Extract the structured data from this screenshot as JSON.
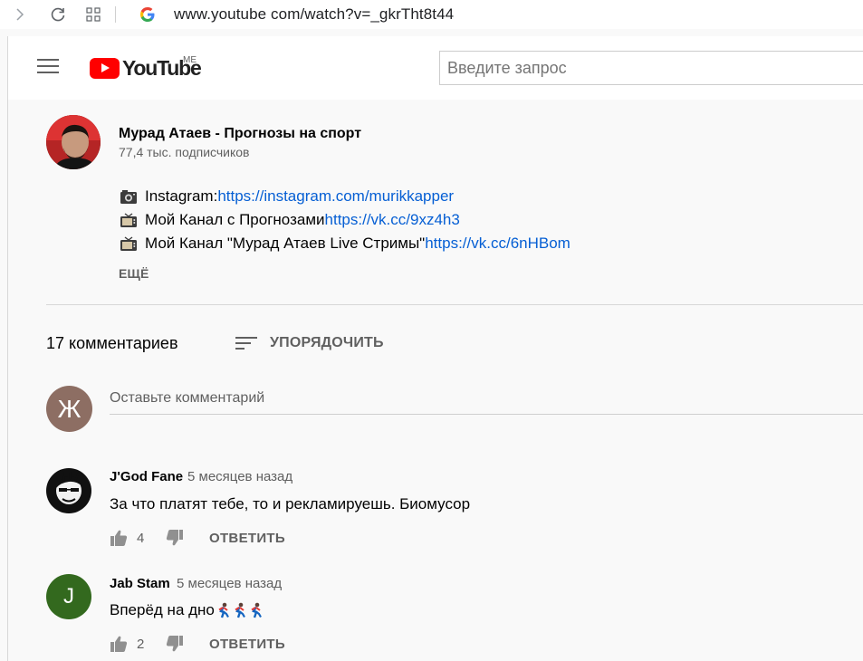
{
  "browser": {
    "url": "www.youtube  com/watch?v=_gkrTht8t44"
  },
  "header": {
    "logo_text": "YouTube",
    "country_code": "ME",
    "search_placeholder": "Введите запрос"
  },
  "channel": {
    "name": "Мурад Атаев - Прогнозы на спорт",
    "subscribers": "77,4 тыс. подписчиков"
  },
  "description": {
    "lines": [
      {
        "icon": "camera-icon",
        "text": "Instagram: ",
        "link": "https://instagram.com/murikkapper"
      },
      {
        "icon": "tv-icon",
        "text": "Мой Канал с Прогнозами ",
        "link": "https://vk.cc/9xz4h3"
      },
      {
        "icon": "tv-icon",
        "text": "Мой Канал \"Мурад Атаев Live Стримы\" ",
        "link": "https://vk.cc/6nHBom"
      }
    ],
    "more_label": "ЕЩЁ"
  },
  "comments_section": {
    "count_label": "17 комментариев",
    "sort_label": "УПОРЯДОЧИТЬ",
    "input_placeholder": "Оставьте комментарий",
    "user_avatar_letter": "Ж",
    "user_avatar_color": "#8d6e63"
  },
  "comments": [
    {
      "author": "J'God Fane",
      "time": "5 месяцев назад",
      "text": "За что платят тебе, то и рекламируешь. Биомусор",
      "likes": "4",
      "reply_label": "ОТВЕТИТЬ"
    },
    {
      "author": "Jab Stam",
      "time": "5 месяцев назад",
      "text": "Вперёд на дно",
      "avatar_letter": "J",
      "avatar_color": "#33691e",
      "likes": "2",
      "reply_label": "ОТВЕТИТЬ"
    }
  ],
  "colors": {
    "link": "#065fd4",
    "brand_red": "#ff0000",
    "secondary_text": "#606060"
  }
}
